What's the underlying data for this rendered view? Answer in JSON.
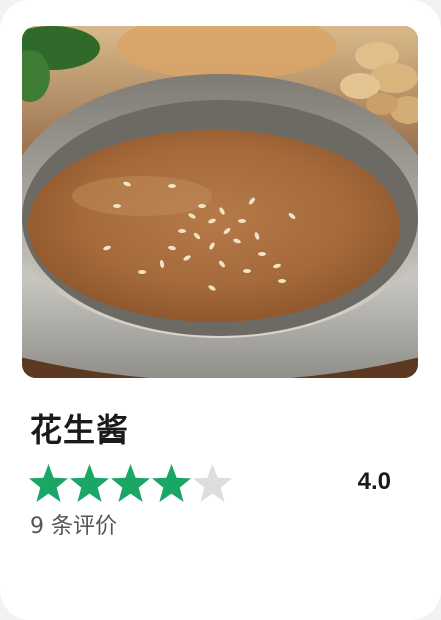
{
  "product": {
    "name": "花生酱",
    "rating_value": "4.0",
    "rating": 4,
    "rating_max": 5,
    "review_count_text": "9 条评价"
  },
  "colors": {
    "star_filled": "#1aa665",
    "star_empty": "#dedede",
    "card_background": "#ffffff",
    "page_background": "#f2f2f2"
  },
  "icons": {
    "star": "star-icon"
  }
}
